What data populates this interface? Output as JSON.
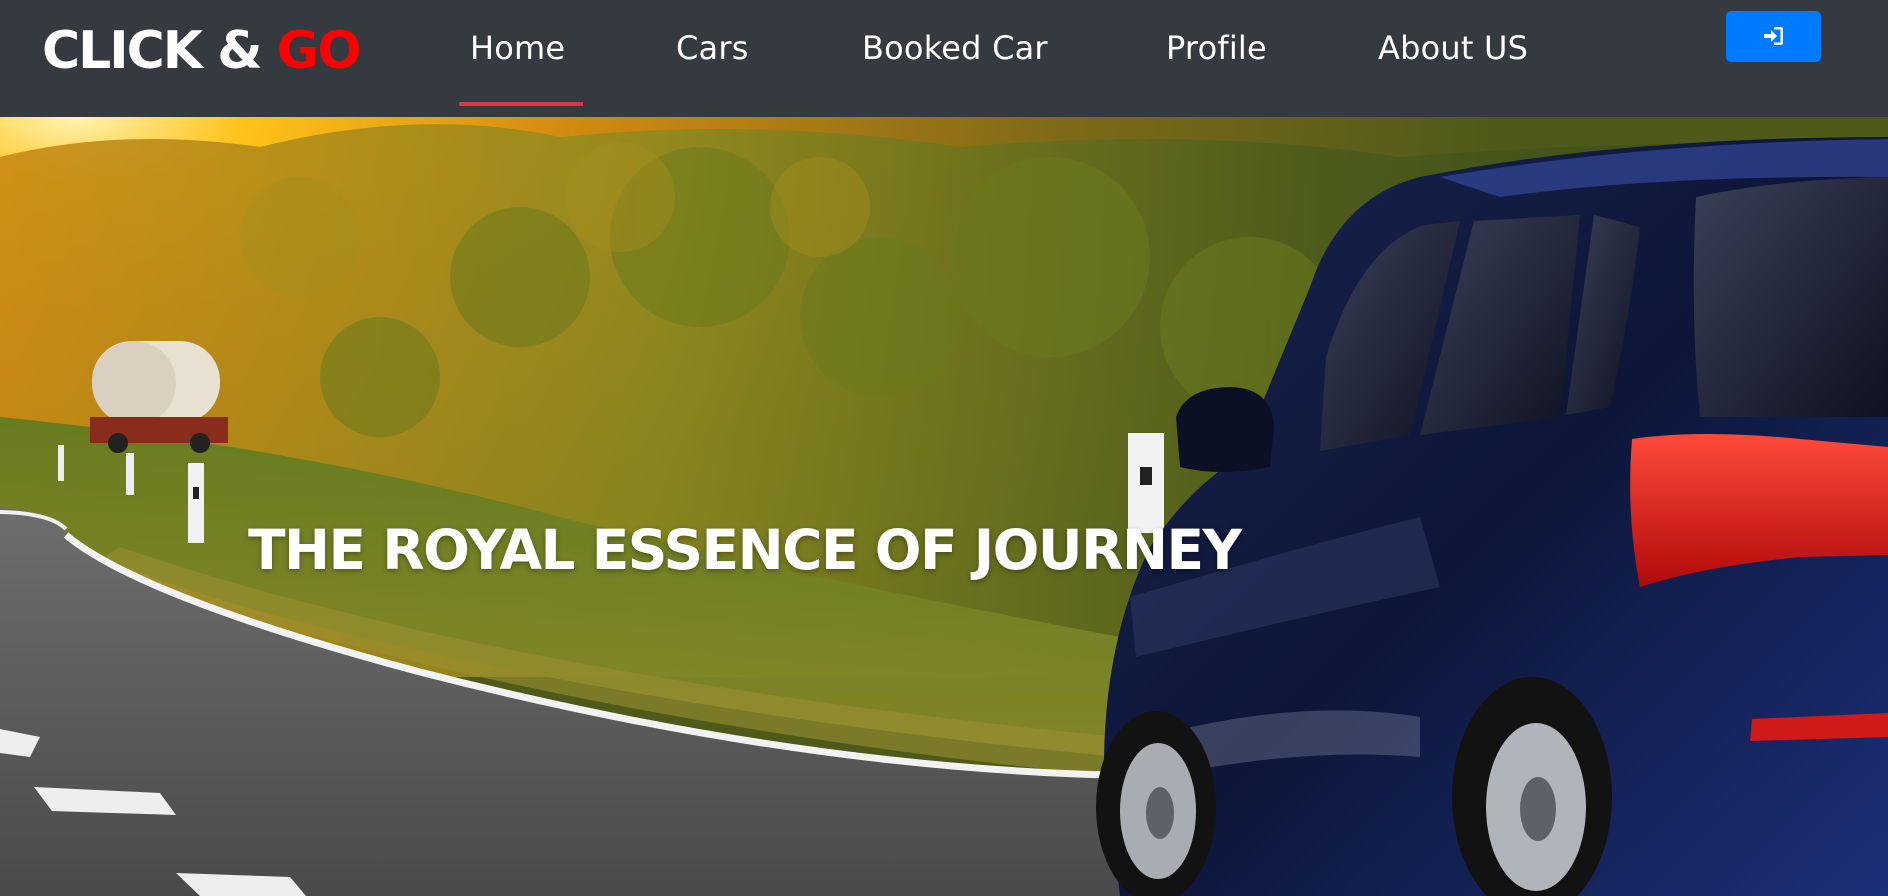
{
  "brand": {
    "part1": "CLICK & ",
    "part2": "GO"
  },
  "nav": {
    "home": "Home",
    "cars": "Cars",
    "booked_car": "Booked Car",
    "profile": "Profile",
    "about": "About US",
    "active": "Home"
  },
  "login_button": {
    "icon": "sign-in-icon"
  },
  "hero": {
    "title": "THE ROYAL ESSENCE OF JOURNEY",
    "image": "road-car-sunset-photo"
  },
  "colors": {
    "navbar_bg": "#343a40",
    "brand_accent": "#ff0000",
    "active_underline": "#dc3545",
    "login_button": "#007bff"
  }
}
